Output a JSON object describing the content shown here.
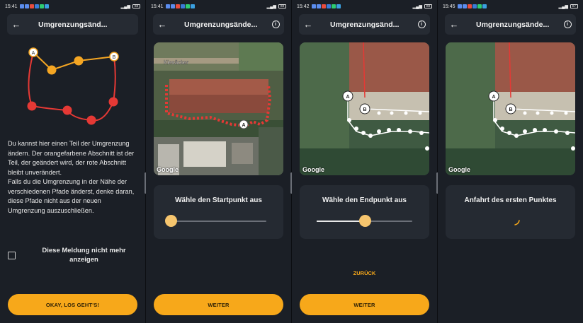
{
  "screens": [
    {
      "status": {
        "time": "15:41",
        "battery": "88"
      },
      "title": "Umgrenzungsänd...",
      "body_text": "Du kannst hier einen Teil der Umgrenzung ändern. Der orangefarbene Abschnitt ist der Teil, der geändert wird, der rote Abschnitt bleibt unverändert.\nFalls du die Umgrenzung in der Nähe der verschiedenen Pfade änderst, denke daran, diese Pfade nicht aus der neuen Umgrenzung auszuschließen.",
      "checkbox_label": "Diese Meldung nicht mehr anzeigen",
      "button_label": "OKAY, LOS GEHT'S!",
      "diagram_labels": {
        "a": "A",
        "b": "B"
      }
    },
    {
      "status": {
        "time": "15:41",
        "battery": "88"
      },
      "title": "Umgrenzungsände...",
      "map_label": "Kiesäcker",
      "marker": "A",
      "google": "Google",
      "card_title": "Wähle den Startpunkt aus",
      "slider_value": 0.0,
      "button_label": "WEITER"
    },
    {
      "status": {
        "time": "15:42",
        "battery": "88"
      },
      "title": "Umgrenzungsänd...",
      "markers": [
        "A",
        "B"
      ],
      "google": "Google",
      "card_title": "Wähle den Endpunkt aus",
      "slider_value": 0.5,
      "back_label": "ZURÜCK",
      "button_label": "WEITER"
    },
    {
      "status": {
        "time": "15:45",
        "battery": "87"
      },
      "title": "Umgrenzungsände...",
      "markers": [
        "A",
        "B"
      ],
      "google": "Google",
      "card_title": "Anfahrt des ersten Punktes"
    }
  ],
  "colors": {
    "accent": "#f7a81a",
    "boundary_red": "#e53935",
    "boundary_orange": "#f5a623",
    "background": "#1b1f26"
  }
}
